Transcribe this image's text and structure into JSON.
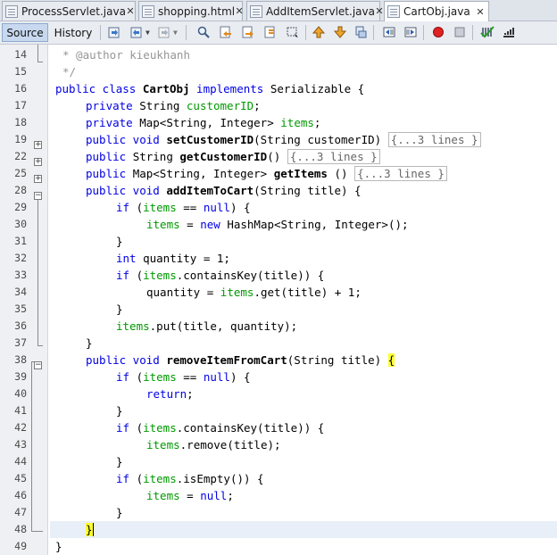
{
  "tabs": [
    {
      "name": "ProcessServlet.java",
      "active": false
    },
    {
      "name": "shopping.html",
      "active": false
    },
    {
      "name": "AddItemServlet.java",
      "active": false
    },
    {
      "name": "CartObj.java",
      "active": true
    }
  ],
  "toolbar": {
    "source_label": "Source",
    "history_label": "History"
  },
  "gutter": {
    "line_numbers": [
      "14",
      "15",
      "16",
      "17",
      "18",
      "19",
      "22",
      "25",
      "28",
      "29",
      "30",
      "31",
      "32",
      "33",
      "34",
      "35",
      "36",
      "37",
      "38",
      "39",
      "40",
      "41",
      "42",
      "43",
      "44",
      "45",
      "46",
      "47",
      "48",
      "49"
    ]
  },
  "code": {
    "l14": "* @author kieukhanh",
    "l15": "*/",
    "l16": [
      "public class ",
      "CartObj",
      " implements ",
      "Serializable {"
    ],
    "l17": [
      "private ",
      "String ",
      "customerID",
      ";"
    ],
    "l18": [
      "private ",
      "Map<String, Integer> ",
      "items",
      ";"
    ],
    "l19": [
      "public void ",
      "setCustomerID",
      "(String customerID)",
      "{...3 lines }"
    ],
    "l22": [
      "public ",
      "String ",
      "getCustomerID",
      "()",
      "{...3 lines }"
    ],
    "l25": [
      "public ",
      "Map<String, Integer> ",
      "getItems",
      " ()",
      "{...3 lines }"
    ],
    "l28": [
      "public void ",
      "addItemToCart",
      "(String title) {"
    ],
    "l29": [
      "if ",
      "(",
      "items",
      " == ",
      "null",
      ") {"
    ],
    "l30": [
      "items",
      " = ",
      "new ",
      "HashMap<String, Integer>();"
    ],
    "l31": "}",
    "l32": [
      "int ",
      "quantity = 1;"
    ],
    "l33": [
      "if ",
      "(",
      "items",
      ".containsKey(title)) {"
    ],
    "l34": [
      "quantity = ",
      "items",
      ".get(title) + 1;"
    ],
    "l35": "}",
    "l36": [
      "items",
      ".put(title, quantity);"
    ],
    "l37": "}",
    "l38": [
      "public void ",
      "removeItemFromCart",
      "(String title) ",
      "{"
    ],
    "l39": [
      "if ",
      "(",
      "items",
      " == ",
      "null",
      ") {"
    ],
    "l40": [
      "return",
      ";"
    ],
    "l41": "}",
    "l42": [
      "if ",
      "(",
      "items",
      ".containsKey(title)) {"
    ],
    "l43": [
      "items",
      ".remove(title);"
    ],
    "l44": "}",
    "l45": [
      "if ",
      "(",
      "items",
      ".isEmpty()) {"
    ],
    "l46": [
      "items",
      " = ",
      "null",
      ";"
    ],
    "l47": "}",
    "l48": "}",
    "l49": "}"
  }
}
